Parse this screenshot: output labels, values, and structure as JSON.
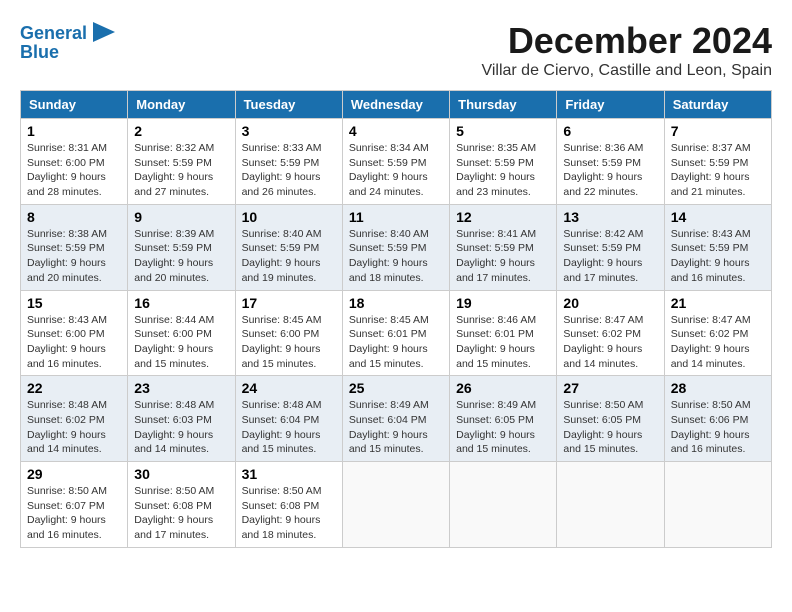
{
  "logo": {
    "line1": "General",
    "line2": "Blue"
  },
  "header": {
    "month": "December 2024",
    "location": "Villar de Ciervo, Castille and Leon, Spain"
  },
  "weekdays": [
    "Sunday",
    "Monday",
    "Tuesday",
    "Wednesday",
    "Thursday",
    "Friday",
    "Saturday"
  ],
  "weeks": [
    [
      {
        "day": "1",
        "sunrise": "Sunrise: 8:31 AM",
        "sunset": "Sunset: 6:00 PM",
        "daylight": "Daylight: 9 hours and 28 minutes."
      },
      {
        "day": "2",
        "sunrise": "Sunrise: 8:32 AM",
        "sunset": "Sunset: 5:59 PM",
        "daylight": "Daylight: 9 hours and 27 minutes."
      },
      {
        "day": "3",
        "sunrise": "Sunrise: 8:33 AM",
        "sunset": "Sunset: 5:59 PM",
        "daylight": "Daylight: 9 hours and 26 minutes."
      },
      {
        "day": "4",
        "sunrise": "Sunrise: 8:34 AM",
        "sunset": "Sunset: 5:59 PM",
        "daylight": "Daylight: 9 hours and 24 minutes."
      },
      {
        "day": "5",
        "sunrise": "Sunrise: 8:35 AM",
        "sunset": "Sunset: 5:59 PM",
        "daylight": "Daylight: 9 hours and 23 minutes."
      },
      {
        "day": "6",
        "sunrise": "Sunrise: 8:36 AM",
        "sunset": "Sunset: 5:59 PM",
        "daylight": "Daylight: 9 hours and 22 minutes."
      },
      {
        "day": "7",
        "sunrise": "Sunrise: 8:37 AM",
        "sunset": "Sunset: 5:59 PM",
        "daylight": "Daylight: 9 hours and 21 minutes."
      }
    ],
    [
      {
        "day": "8",
        "sunrise": "Sunrise: 8:38 AM",
        "sunset": "Sunset: 5:59 PM",
        "daylight": "Daylight: 9 hours and 20 minutes."
      },
      {
        "day": "9",
        "sunrise": "Sunrise: 8:39 AM",
        "sunset": "Sunset: 5:59 PM",
        "daylight": "Daylight: 9 hours and 20 minutes."
      },
      {
        "day": "10",
        "sunrise": "Sunrise: 8:40 AM",
        "sunset": "Sunset: 5:59 PM",
        "daylight": "Daylight: 9 hours and 19 minutes."
      },
      {
        "day": "11",
        "sunrise": "Sunrise: 8:40 AM",
        "sunset": "Sunset: 5:59 PM",
        "daylight": "Daylight: 9 hours and 18 minutes."
      },
      {
        "day": "12",
        "sunrise": "Sunrise: 8:41 AM",
        "sunset": "Sunset: 5:59 PM",
        "daylight": "Daylight: 9 hours and 17 minutes."
      },
      {
        "day": "13",
        "sunrise": "Sunrise: 8:42 AM",
        "sunset": "Sunset: 5:59 PM",
        "daylight": "Daylight: 9 hours and 17 minutes."
      },
      {
        "day": "14",
        "sunrise": "Sunrise: 8:43 AM",
        "sunset": "Sunset: 5:59 PM",
        "daylight": "Daylight: 9 hours and 16 minutes."
      }
    ],
    [
      {
        "day": "15",
        "sunrise": "Sunrise: 8:43 AM",
        "sunset": "Sunset: 6:00 PM",
        "daylight": "Daylight: 9 hours and 16 minutes."
      },
      {
        "day": "16",
        "sunrise": "Sunrise: 8:44 AM",
        "sunset": "Sunset: 6:00 PM",
        "daylight": "Daylight: 9 hours and 15 minutes."
      },
      {
        "day": "17",
        "sunrise": "Sunrise: 8:45 AM",
        "sunset": "Sunset: 6:00 PM",
        "daylight": "Daylight: 9 hours and 15 minutes."
      },
      {
        "day": "18",
        "sunrise": "Sunrise: 8:45 AM",
        "sunset": "Sunset: 6:01 PM",
        "daylight": "Daylight: 9 hours and 15 minutes."
      },
      {
        "day": "19",
        "sunrise": "Sunrise: 8:46 AM",
        "sunset": "Sunset: 6:01 PM",
        "daylight": "Daylight: 9 hours and 15 minutes."
      },
      {
        "day": "20",
        "sunrise": "Sunrise: 8:47 AM",
        "sunset": "Sunset: 6:02 PM",
        "daylight": "Daylight: 9 hours and 14 minutes."
      },
      {
        "day": "21",
        "sunrise": "Sunrise: 8:47 AM",
        "sunset": "Sunset: 6:02 PM",
        "daylight": "Daylight: 9 hours and 14 minutes."
      }
    ],
    [
      {
        "day": "22",
        "sunrise": "Sunrise: 8:48 AM",
        "sunset": "Sunset: 6:02 PM",
        "daylight": "Daylight: 9 hours and 14 minutes."
      },
      {
        "day": "23",
        "sunrise": "Sunrise: 8:48 AM",
        "sunset": "Sunset: 6:03 PM",
        "daylight": "Daylight: 9 hours and 14 minutes."
      },
      {
        "day": "24",
        "sunrise": "Sunrise: 8:48 AM",
        "sunset": "Sunset: 6:04 PM",
        "daylight": "Daylight: 9 hours and 15 minutes."
      },
      {
        "day": "25",
        "sunrise": "Sunrise: 8:49 AM",
        "sunset": "Sunset: 6:04 PM",
        "daylight": "Daylight: 9 hours and 15 minutes."
      },
      {
        "day": "26",
        "sunrise": "Sunrise: 8:49 AM",
        "sunset": "Sunset: 6:05 PM",
        "daylight": "Daylight: 9 hours and 15 minutes."
      },
      {
        "day": "27",
        "sunrise": "Sunrise: 8:50 AM",
        "sunset": "Sunset: 6:05 PM",
        "daylight": "Daylight: 9 hours and 15 minutes."
      },
      {
        "day": "28",
        "sunrise": "Sunrise: 8:50 AM",
        "sunset": "Sunset: 6:06 PM",
        "daylight": "Daylight: 9 hours and 16 minutes."
      }
    ],
    [
      {
        "day": "29",
        "sunrise": "Sunrise: 8:50 AM",
        "sunset": "Sunset: 6:07 PM",
        "daylight": "Daylight: 9 hours and 16 minutes."
      },
      {
        "day": "30",
        "sunrise": "Sunrise: 8:50 AM",
        "sunset": "Sunset: 6:08 PM",
        "daylight": "Daylight: 9 hours and 17 minutes."
      },
      {
        "day": "31",
        "sunrise": "Sunrise: 8:50 AM",
        "sunset": "Sunset: 6:08 PM",
        "daylight": "Daylight: 9 hours and 18 minutes."
      },
      null,
      null,
      null,
      null
    ]
  ]
}
